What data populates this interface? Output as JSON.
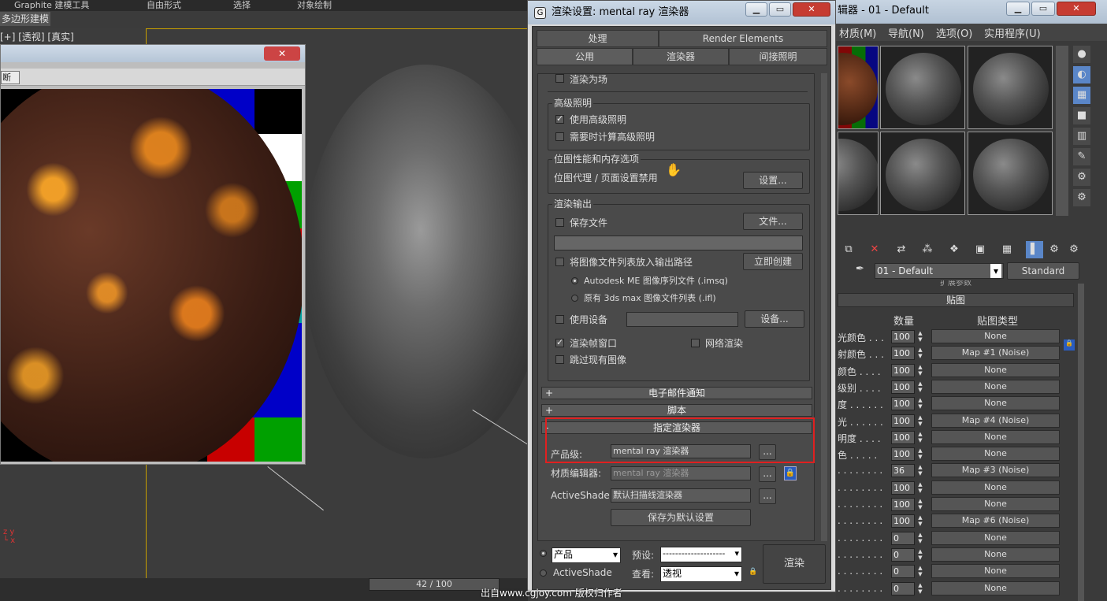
{
  "ribbon": {
    "tab1": "Graphite 建模工具",
    "tab2": "自由形式",
    "tab3": "选择",
    "tab4": "对象绘制",
    "sub": "多边形建模"
  },
  "viewport": {
    "label": "[+] [透视] [真实]"
  },
  "render_frame": {
    "close": "✕",
    "btn": "断"
  },
  "dialog": {
    "title": "渲染设置: mental ray 渲染器",
    "tabs_row1": [
      "处理",
      "Render Elements"
    ],
    "tabs_row2": [
      "公用",
      "渲染器",
      "间接照明"
    ],
    "render_field": "渲染为场",
    "adv_light": {
      "title": "高级照明",
      "use": "使用高级照明",
      "compute": "需要时计算高级照明"
    },
    "bitmap": {
      "title": "位图性能和内存选项",
      "text": "位图代理 / 页面设置禁用",
      "btn": "设置..."
    },
    "output": {
      "title": "渲染输出",
      "save_file": "保存文件",
      "files_btn": "文件...",
      "put_list": "将图像文件列表放入输出路径",
      "create_btn": "立即创建",
      "opt1": "Autodesk ME 图像序列文件 (.imsq)",
      "opt2": "原有 3ds max 图像文件列表 (.ifl)",
      "use_device": "使用设备",
      "devices_btn": "设备...",
      "frame_window": "渲染帧窗口",
      "net_render": "网络渲染",
      "skip": "跳过现有图像"
    },
    "email": "电子邮件通知",
    "scripts": "脚本",
    "assign": {
      "title": "指定渲染器",
      "production_label": "产品级:",
      "production_value": "mental ray 渲染器",
      "mat_label": "材质编辑器:",
      "mat_value": "mental ray 渲染器",
      "as_label": "ActiveShade:",
      "as_value": "默认扫描线渲染器",
      "save_default": "保存为默认设置",
      "browse": "..."
    },
    "bottom": {
      "production": "产品",
      "activeshade": "ActiveShade",
      "preset_label": "预设:",
      "preset_value": "--------------------",
      "view_label": "查看:",
      "view_value": "透视",
      "render_btn": "渲染"
    }
  },
  "med": {
    "title": "辑器 - 01 - Default",
    "menu": [
      "材质(M)",
      "导航(N)",
      "选项(O)",
      "实用程序(U)"
    ],
    "material_name": "01 - Default",
    "material_type": "Standard",
    "rollout_top": "扩展参数",
    "rollout": "贴图",
    "col_amount": "数量",
    "col_type": "贴图类型",
    "rows": [
      {
        "label": "光颜色 . . .",
        "amount": "100",
        "map": "None"
      },
      {
        "label": "射颜色 . . .",
        "amount": "100",
        "map": "Map #1 (Noise)"
      },
      {
        "label": "颜色 . . . .",
        "amount": "100",
        "map": "None"
      },
      {
        "label": "级别 . . . .",
        "amount": "100",
        "map": "None"
      },
      {
        "label": "度 . . . . . .",
        "amount": "100",
        "map": "None"
      },
      {
        "label": "光 . . . . . .",
        "amount": "100",
        "map": "Map #4 (Noise)"
      },
      {
        "label": "明度 . . . .",
        "amount": "100",
        "map": "None"
      },
      {
        "label": "色 . . . . .",
        "amount": "100",
        "map": "None"
      },
      {
        "label": ". . . . . . . .",
        "amount": "36",
        "map": "Map #3 (Noise)"
      },
      {
        "label": ". . . . . . . .",
        "amount": "100",
        "map": "None"
      },
      {
        "label": ". . . . . . . .",
        "amount": "100",
        "map": "None"
      },
      {
        "label": ". . . . . . . .",
        "amount": "100",
        "map": "Map #6 (Noise)"
      },
      {
        "label": ". . . . . . . .",
        "amount": "0",
        "map": "None"
      },
      {
        "label": ". . . . . . . .",
        "amount": "0",
        "map": "None"
      },
      {
        "label": ". . . . . . . .",
        "amount": "0",
        "map": "None"
      },
      {
        "label": ". . . . . . . .",
        "amount": "0",
        "map": "None"
      }
    ]
  },
  "timeline": {
    "value": "42 / 100"
  },
  "watermark": "出自www.cgjoy.com 版权归作者"
}
